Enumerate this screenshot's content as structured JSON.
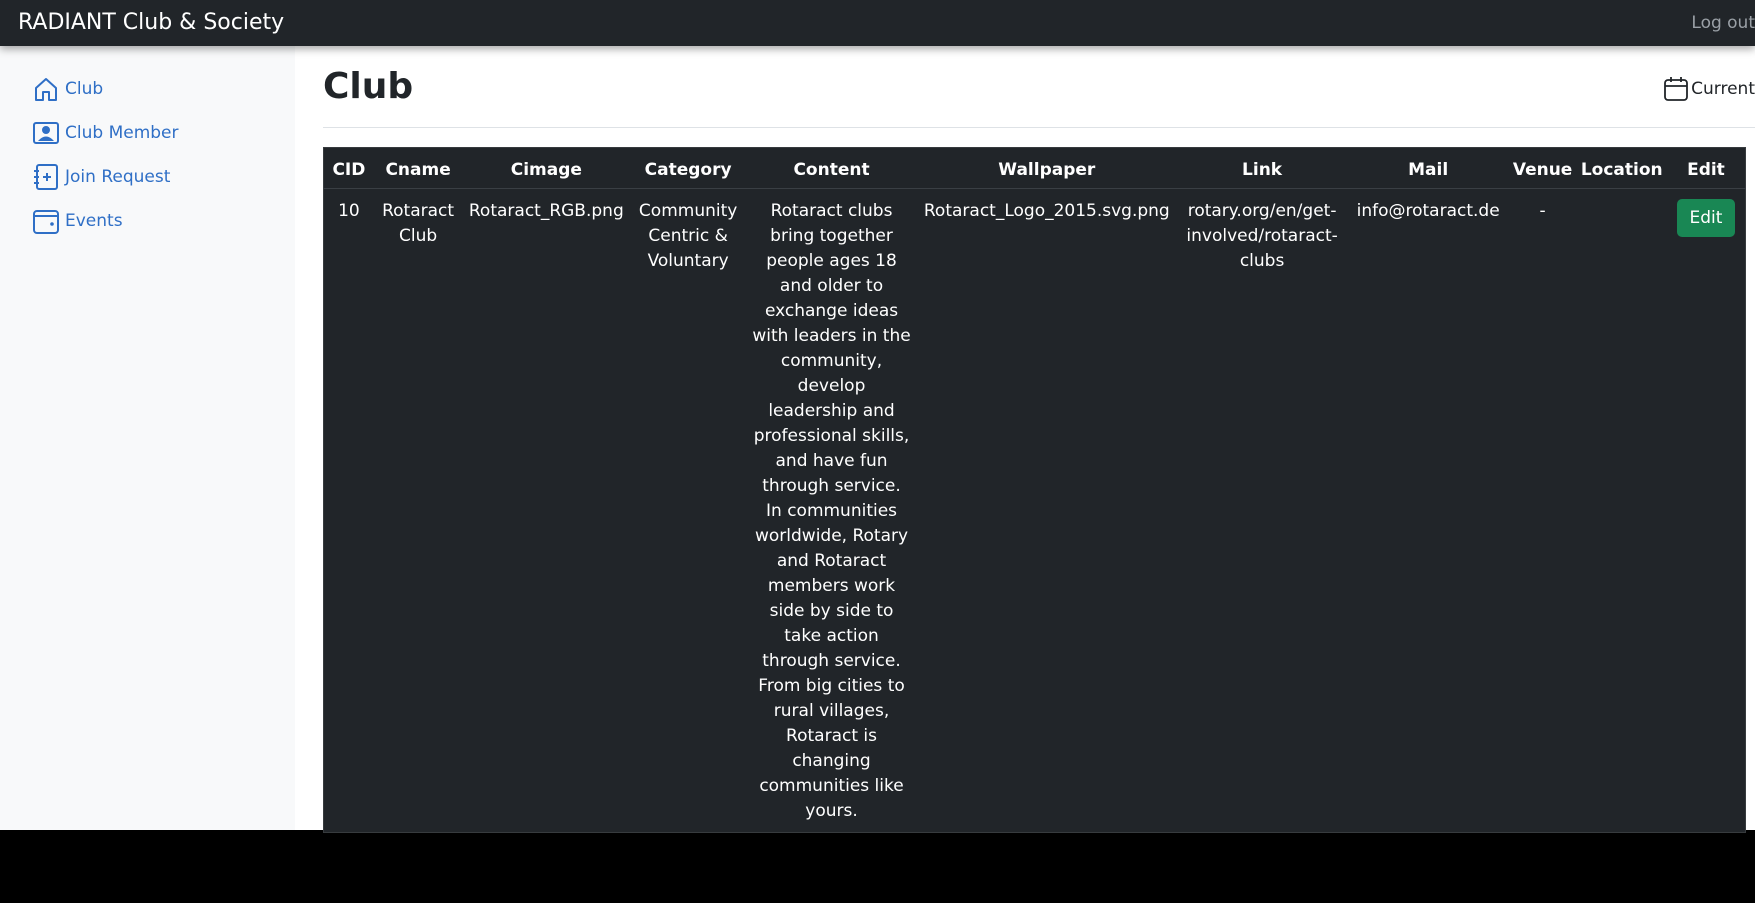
{
  "header": {
    "brand": "RADIANT Club & Society",
    "logout_label": "Log out"
  },
  "sidebar": {
    "items": [
      {
        "label": "Club",
        "icon": "house-icon"
      },
      {
        "label": "Club Member",
        "icon": "person-badge-icon"
      },
      {
        "label": "Join Request",
        "icon": "journal-plus-icon"
      },
      {
        "label": "Events",
        "icon": "wallet-icon"
      }
    ]
  },
  "main": {
    "title": "Club",
    "current_label": "Current",
    "table": {
      "columns": [
        "CID",
        "Cname",
        "Cimage",
        "Category",
        "Content",
        "Wallpaper",
        "Link",
        "Mail",
        "Venue",
        "Location",
        "Edit"
      ],
      "rows": [
        {
          "cid": "10",
          "cname": "Rotaract Club",
          "cimage": "Rotaract_RGB.png",
          "category": "Community Centric & Voluntary",
          "content": "Rotaract clubs bring together people ages 18 and older to exchange ideas with leaders in the community, develop leadership and professional skills, and have fun through service. In communities worldwide, Rotary and Rotaract members work side by side to take action through service. From big cities to rural villages, Rotaract is changing communities like yours.",
          "wallpaper": "Rotaract_Logo_2015.svg.png",
          "link": "rotary.org/en/get-involved/rotaract-clubs",
          "mail": "info@rotaract.de",
          "venue": "-",
          "location": "",
          "edit_label": "Edit"
        }
      ]
    }
  },
  "colors": {
    "topbar": "#212529",
    "sidebar": "#f8f9fa",
    "link": "#2f6fc6",
    "table_bg": "#212529",
    "edit_button": "#198754"
  }
}
